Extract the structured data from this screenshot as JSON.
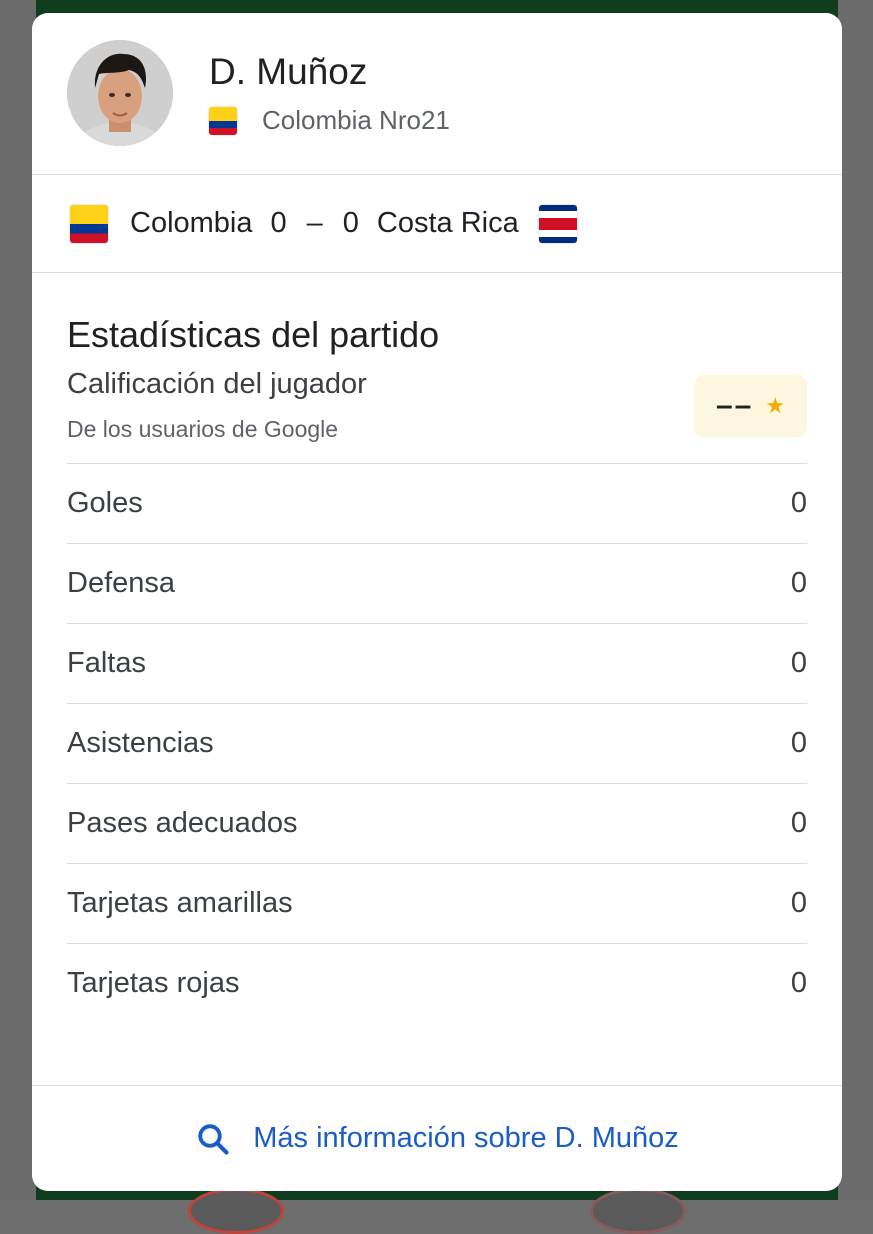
{
  "player": {
    "name": "D. Muñoz",
    "team_number": "Colombia Nro21",
    "flag_icon": "colombia-flag-icon"
  },
  "match": {
    "home_team": "Colombia",
    "home_score": "0",
    "separator": "–",
    "away_score": "0",
    "away_team": "Costa Rica"
  },
  "stats": {
    "title": "Estadísticas del partido",
    "rating": {
      "label": "Calificación del jugador",
      "sublabel": "De los usuarios de Google",
      "value": "––",
      "star": "★"
    },
    "rows": [
      {
        "label": "Goles",
        "value": "0"
      },
      {
        "label": "Defensa",
        "value": "0"
      },
      {
        "label": "Faltas",
        "value": "0"
      },
      {
        "label": "Asistencias",
        "value": "0"
      },
      {
        "label": "Pases adecuados",
        "value": "0"
      },
      {
        "label": "Tarjetas amarillas",
        "value": "0"
      },
      {
        "label": "Tarjetas rojas",
        "value": "0"
      }
    ]
  },
  "footer": {
    "link_text": "Más información sobre D. Muñoz"
  },
  "colors": {
    "accent_link": "#1a5cc8",
    "rating_bg": "#fef7e0",
    "star": "#f9ab00",
    "backdrop_green": "#0f3d1e"
  }
}
